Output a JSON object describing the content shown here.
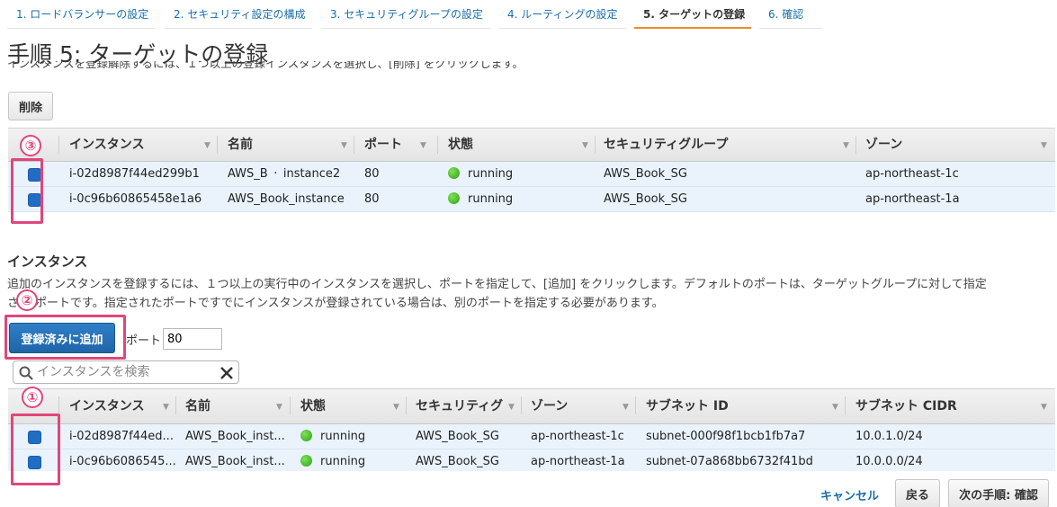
{
  "wizard": {
    "steps": [
      {
        "label": "1. ロードバランサーの設定"
      },
      {
        "label": "2. セキュリティ設定の構成"
      },
      {
        "label": "3. セキュリティグループの設定"
      },
      {
        "label": "4. ルーティングの設定"
      },
      {
        "label": "5. ターゲットの登録"
      },
      {
        "label": "6. 確認"
      }
    ]
  },
  "page": {
    "title": "手順 5: ターゲットの登録",
    "subtitle": "インスタンスを登録解除するには、１つ以上の登録インスタンスを選択し、[削除] をクリックします。"
  },
  "registered": {
    "delete_label": "削除",
    "columns": [
      "インスタンス",
      "名前",
      "ポート",
      "状態",
      "セキュリティグループ",
      "ゾーン"
    ],
    "rows": [
      {
        "instance": "i-02d8987f44ed299b1",
        "name": "AWS_B​ · instance2",
        "port": "80",
        "state": "running",
        "sg": "AWS_Book_SG",
        "zone": "ap-northeast-1c"
      },
      {
        "instance": "i-0c96b60865458e1a6",
        "name": "AWS_Book_instance",
        "port": "80",
        "state": "running",
        "sg": "AWS_Book_SG",
        "zone": "ap-northeast-1a"
      }
    ]
  },
  "instances": {
    "section_title": "インスタンス",
    "desc_line1": "追加のインスタンスを登録するには、１つ以上の実行中のインスタンスを選択し、ポートを指定して、[追加] をクリックします。デフォルトのポートは、ターゲットグループに対して指定",
    "desc_line2": "さ",
    "desc_line2b": "ポートです。指定されたポートですでにインスタンスが登録されている場合は、別のポートを指定する必要があります。",
    "add_label": "登録済みに追加",
    "port_label": "ポート",
    "port_value": "80",
    "search_placeholder": "インスタンスを検索",
    "columns": [
      "インスタンス",
      "名前",
      "状態",
      "セキュリティグ",
      "ゾーン",
      "サブネット ID",
      "サブネット CIDR"
    ],
    "rows": [
      {
        "instance": "i-02d8987f44ed...",
        "name": "AWS_Book_inst...",
        "state": "running",
        "sg": "AWS_Book_SG",
        "zone": "ap-northeast-1c",
        "subnet": "subnet-000f98f1bcb1fb7a7",
        "cidr": "10.0.1.0/24"
      },
      {
        "instance": "i-0c96b6086545...",
        "name": "AWS_Book_inst...",
        "state": "running",
        "sg": "AWS_Book_SG",
        "zone": "ap-northeast-1a",
        "subnet": "subnet-07a868bb6732f41bd",
        "cidr": "10.0.0.0/24"
      }
    ]
  },
  "annotations": {
    "one": "①",
    "two": "②",
    "three": "③"
  },
  "footer": {
    "cancel_label": "キャンセル",
    "back_label": "戻る",
    "next_label": "次の手順: 確認"
  },
  "colors": {
    "link": "#1a6ea9",
    "active_tab": "#f08a24",
    "primary": "#1f65a8",
    "highlight": "#e0467a",
    "row_selected": "#eaf3fc",
    "status_running": "#2f9e14"
  }
}
